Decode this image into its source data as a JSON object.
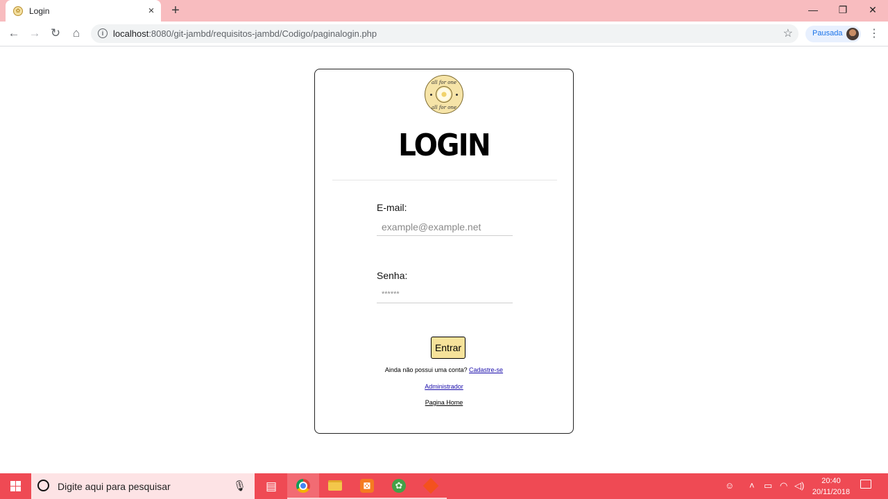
{
  "browser": {
    "tab_title": "Login",
    "tab_close": "×",
    "new_tab": "+",
    "url_host": "localhost",
    "url_rest": ":8080/git-jambd/requisitos-jambd/Codigo/paginalogin.php",
    "profile_label": "Pausada",
    "window_controls": {
      "minimize": "—",
      "restore": "❐",
      "close": "✕"
    }
  },
  "login": {
    "title": "LOGIN",
    "logo_text_top": "all for one",
    "logo_text_bottom": "all for one",
    "email_label": "E-mail:",
    "email_placeholder": "example@example.net",
    "password_label": "Senha:",
    "password_placeholder": "******",
    "submit_label": "Entrar",
    "no_account_text": "Ainda não possui uma conta?",
    "signup_link": "Cadastre-se",
    "admin_link": "Administrador",
    "home_link": "Pagina Home",
    "accent_color": "#f6e29a"
  },
  "taskbar": {
    "search_placeholder": "Digite aqui para pesquisar",
    "time": "20:40",
    "date": "20/11/2018",
    "color": "#ef4a54"
  },
  "titlebar_color": "#f8bcbf"
}
